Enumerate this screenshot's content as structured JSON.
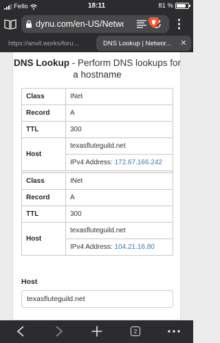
{
  "status_bar": {
    "carrier": "Fello",
    "time": "18:11",
    "battery_text": "81 %",
    "battery_level": 0.81
  },
  "url_bar": {
    "url": "dynu.com/en-US/Netwo"
  },
  "tabs": [
    {
      "label": "https://anvil.works/foru...",
      "active": false
    },
    {
      "label": "DNS Lookup | Networ...",
      "active": true
    }
  ],
  "page": {
    "title_bold": "DNS Lookup",
    "title_rest": " - Perform DNS lookups for a hostname",
    "records": [
      {
        "class": "INet",
        "record": "A",
        "ttl": "300",
        "host": "texasfluteguild.net",
        "ip_prefix": "IPv4 Address: ",
        "ip": "172.67.166.242"
      },
      {
        "class": "INet",
        "record": "A",
        "ttl": "300",
        "host": "texasfluteguild.net",
        "ip_prefix": "IPv4 Address: ",
        "ip": "104.21.16.80"
      }
    ],
    "keys": {
      "class": "Class",
      "record": "Record",
      "ttl": "TTL",
      "host": "Host"
    },
    "host_label": "Host",
    "host_value": "texasfluteguild.net"
  },
  "toolbar": {
    "tabs_count": "2"
  },
  "colors": {
    "chrome": "#2c2c2e",
    "link": "#3a78b5",
    "brave": "#fb542b"
  }
}
